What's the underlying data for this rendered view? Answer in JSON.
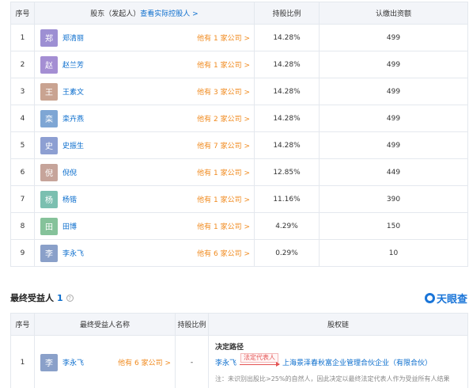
{
  "shareholders": {
    "headers": {
      "index": "序号",
      "name_prefix": "股东（发起人）",
      "name_link": "查看实际控股人 >",
      "ratio": "持股比例",
      "amount": "认缴出资额"
    },
    "rows": [
      {
        "index": "1",
        "avatar": "郑",
        "avatar_color": "#9d8fd3",
        "name": "郑清丽",
        "others": "他有 1 家公司 >",
        "ratio": "14.28%",
        "amount": "499"
      },
      {
        "index": "2",
        "avatar": "赵",
        "avatar_color": "#a48ed3",
        "name": "赵兰芳",
        "others": "他有 1 家公司 >",
        "ratio": "14.28%",
        "amount": "499"
      },
      {
        "index": "3",
        "avatar": "王",
        "avatar_color": "#c9a391",
        "name": "王素文",
        "others": "他有 3 家公司 >",
        "ratio": "14.28%",
        "amount": "499"
      },
      {
        "index": "4",
        "avatar": "栾",
        "avatar_color": "#7ea6d4",
        "name": "栾卉燕",
        "others": "他有 2 家公司 >",
        "ratio": "14.28%",
        "amount": "499"
      },
      {
        "index": "5",
        "avatar": "史",
        "avatar_color": "#8d9fd2",
        "name": "史振生",
        "others": "他有 7 家公司 >",
        "ratio": "14.28%",
        "amount": "499"
      },
      {
        "index": "6",
        "avatar": "倪",
        "avatar_color": "#c6a49a",
        "name": "倪倪",
        "others": "他有 1 家公司 >",
        "ratio": "12.85%",
        "amount": "449"
      },
      {
        "index": "7",
        "avatar": "杨",
        "avatar_color": "#7bbfb0",
        "name": "杨锴",
        "others": "他有 1 家公司 >",
        "ratio": "11.16%",
        "amount": "390"
      },
      {
        "index": "8",
        "avatar": "田",
        "avatar_color": "#85c29a",
        "name": "田博",
        "others": "他有 1 家公司 >",
        "ratio": "4.29%",
        "amount": "150"
      },
      {
        "index": "9",
        "avatar": "李",
        "avatar_color": "#8aa0c9",
        "name": "李永飞",
        "others": "他有 6 家公司 >",
        "ratio": "0.29%",
        "amount": "10"
      }
    ]
  },
  "beneficiary": {
    "title": "最终受益人",
    "count": "1",
    "help_icon": "?",
    "logo": "天眼查",
    "headers": {
      "index": "序号",
      "name": "最终受益人名称",
      "ratio": "持股比例",
      "chain": "股权链"
    },
    "rows": [
      {
        "index": "1",
        "avatar": "李",
        "avatar_color": "#8aa0c9",
        "name": "李永飞",
        "others": "他有 6 家公司 >",
        "ratio": "-",
        "chain_title": "决定路径",
        "chain_from": "李永飞",
        "chain_tag": "法定代表人",
        "chain_to": "上海景泽春秋富企业管理合伙企业（有限合伙）",
        "chain_note": "注：未识别出股比>25%的自然人，因此决定以最终法定代表人作为受益所有人结果"
      }
    ]
  }
}
